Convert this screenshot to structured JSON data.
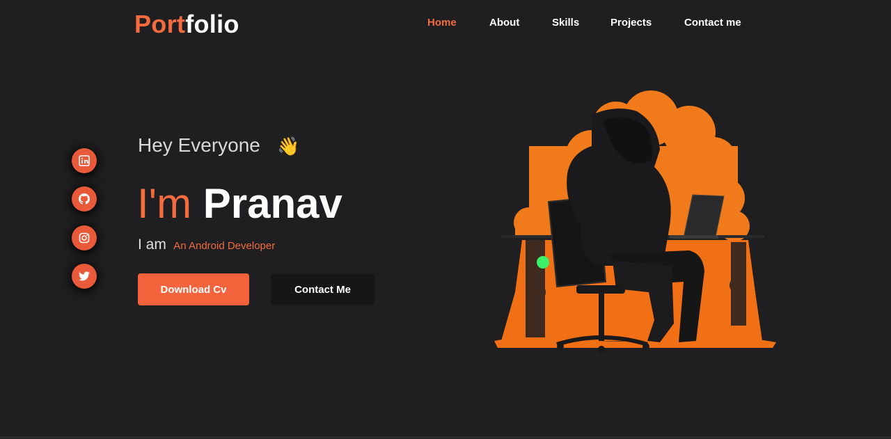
{
  "header": {
    "logo_accent": "Port",
    "logo_rest": "folio",
    "nav": [
      {
        "label": "Home",
        "active": true
      },
      {
        "label": "About",
        "active": false
      },
      {
        "label": "Skills",
        "active": false
      },
      {
        "label": "Projects",
        "active": false
      },
      {
        "label": "Contact me",
        "active": false
      }
    ]
  },
  "socials": [
    {
      "icon": "linkedin-icon"
    },
    {
      "icon": "github-icon"
    },
    {
      "icon": "instagram-icon"
    },
    {
      "icon": "twitter-icon"
    }
  ],
  "hero": {
    "greeting": "Hey Everyone",
    "wave": "👋",
    "im": "I'm",
    "name": "Pranav",
    "iam": "I am",
    "role": "An Android Developer",
    "download_label": "Download Cv",
    "contact_label": "Contact Me"
  },
  "colors": {
    "accent": "#f36b3f",
    "background": "#1f1f21",
    "status_dot": "#3df06a"
  }
}
